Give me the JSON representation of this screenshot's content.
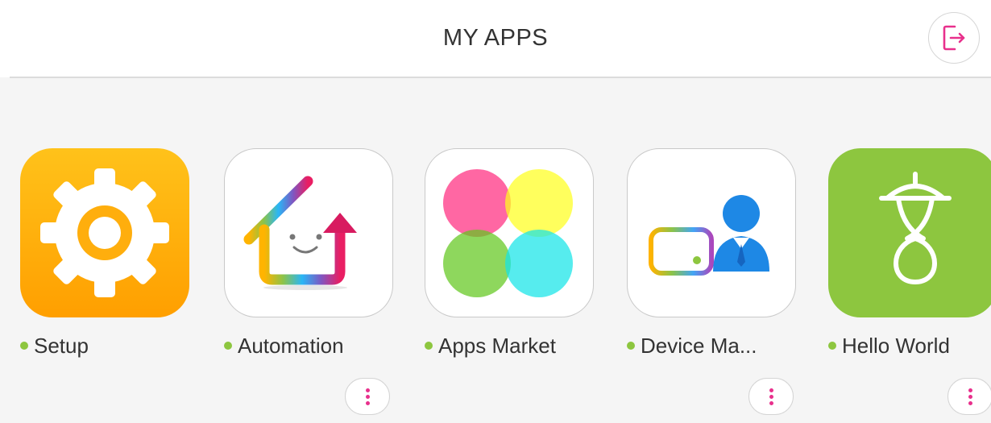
{
  "header": {
    "title": "MY APPS",
    "logout_icon": "logout-icon"
  },
  "colors": {
    "accent": "#e8308c",
    "status_active": "#8dc63f",
    "setup_gradient_top": "#ffc21a",
    "setup_gradient_bottom": "#ff9f00",
    "hello_world_bg": "#8dc63f"
  },
  "apps": [
    {
      "label": "Setup",
      "icon": "gear-icon",
      "status": "active",
      "has_more_menu": false
    },
    {
      "label": "Automation",
      "icon": "smiling-house-icon",
      "status": "active",
      "has_more_menu": true
    },
    {
      "label": "Apps Market",
      "icon": "four-circles-icon",
      "status": "active",
      "has_more_menu": false
    },
    {
      "label": "Device Ma...",
      "icon": "device-manager-icon",
      "status": "active",
      "has_more_menu": true
    },
    {
      "label": "Hello World",
      "icon": "hello-world-icon",
      "status": "active",
      "has_more_menu": true
    }
  ]
}
